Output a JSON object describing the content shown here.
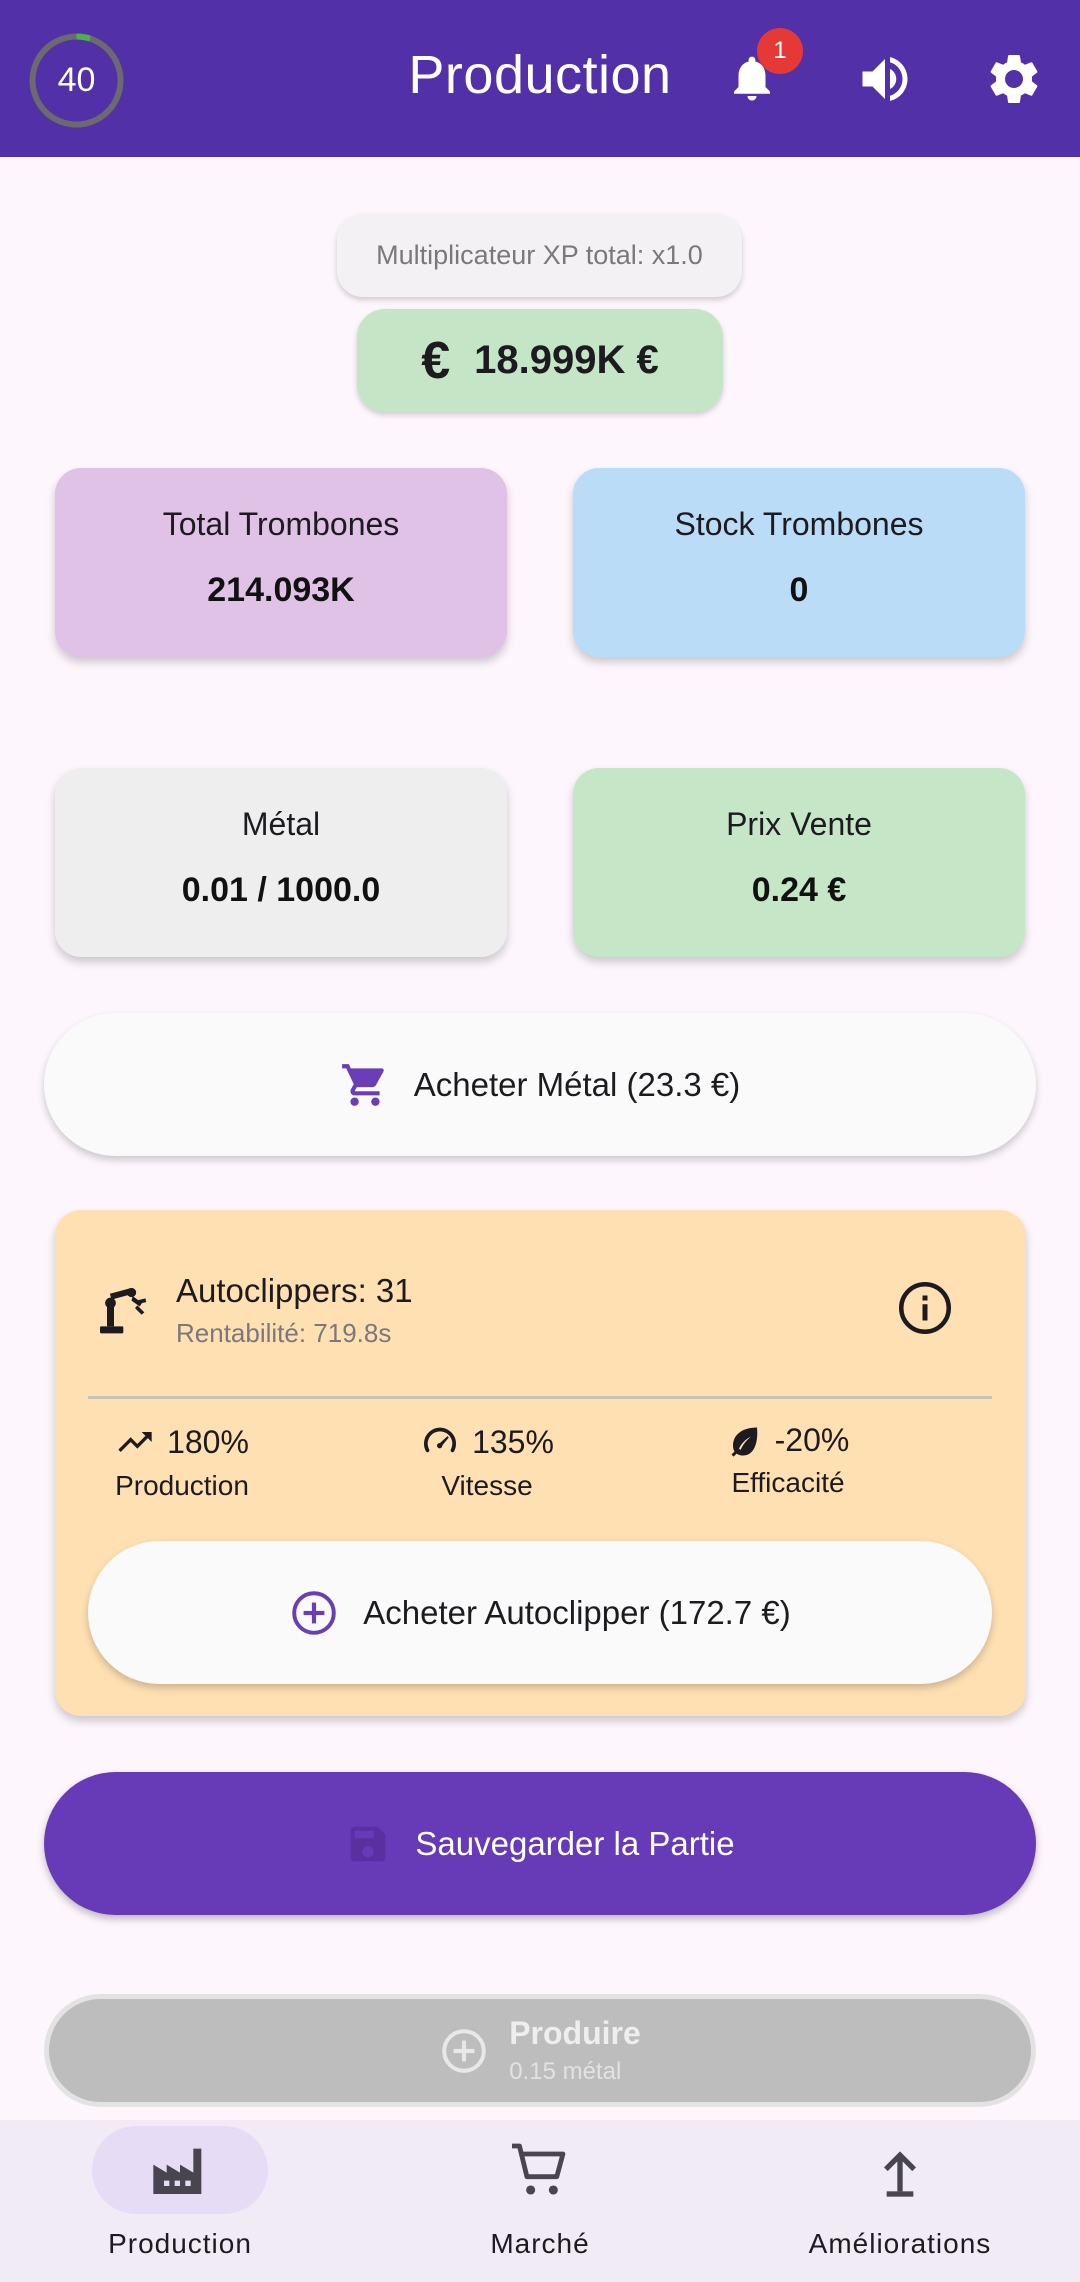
{
  "appbar": {
    "level": "40",
    "level_progress": 0.05,
    "title": "Production",
    "notifications_count": "1",
    "icons": [
      "bell-icon",
      "volume-icon",
      "gear-icon"
    ]
  },
  "xp_multiplier": "Multiplicateur XP total: x1.0",
  "money": "18.999K €",
  "stats": {
    "total_label": "Total Trombones",
    "total_value": "214.093K",
    "stock_label": "Stock Trombones",
    "stock_value": "0",
    "metal_label": "Métal",
    "metal_value": "0.01 / 1000.0",
    "price_label": "Prix Vente",
    "price_value": "0.24 €"
  },
  "buy_metal_label": "Acheter Métal (23.3 €)",
  "autoclippers": {
    "title": "Autoclippers: 31",
    "subtitle": "Rentabilité: 719.8s",
    "metrics": [
      {
        "value": "180%",
        "label": "Production",
        "icon": "trending-up-icon"
      },
      {
        "value": "135%",
        "label": "Vitesse",
        "icon": "speed-icon"
      },
      {
        "value": "-20%",
        "label": "Efficacité",
        "icon": "leaf-icon"
      }
    ],
    "buy_label": "Acheter Autoclipper (172.7 €)"
  },
  "save_label": "Sauvegarder la Partie",
  "produce": {
    "label": "Produire",
    "sub": "0.15 métal"
  },
  "nav": [
    {
      "label": "Production",
      "icon": "factory-icon",
      "active": true
    },
    {
      "label": "Marché",
      "icon": "cart-icon",
      "active": false
    },
    {
      "label": "Améliorations",
      "icon": "upload-arrow-icon",
      "active": false
    }
  ],
  "colors": {
    "primary": "#5230a8",
    "save_button": "#673ab7",
    "money_chip": "#c5e5c7",
    "autoclipper_card": "#ffe0b2",
    "notification": "#e53935"
  }
}
